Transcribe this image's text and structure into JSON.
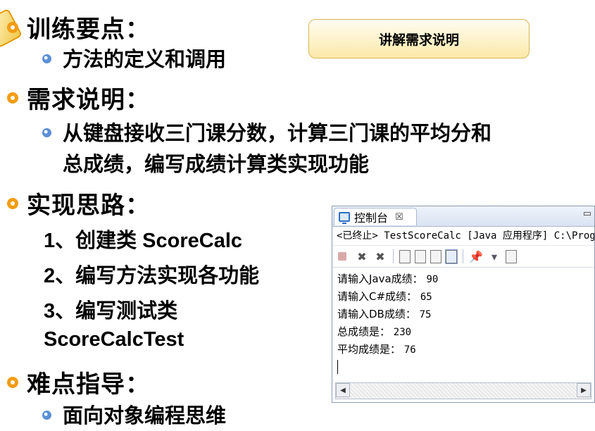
{
  "sections": {
    "points": {
      "title": "训练要点：",
      "items": [
        "方法的定义和调用"
      ]
    },
    "requirement": {
      "title": "需求说明：",
      "lines": [
        "从键盘接收三门课分数，计算三门课的平均分和",
        "总成绩，编写成绩计算类实现功能"
      ]
    },
    "approach": {
      "title": "实现思路：",
      "steps": [
        "1、创建类 ScoreCalc",
        "2、编写方法实现各功能",
        "3、编写测试类",
        "ScoreCalcTest"
      ]
    },
    "difficulty": {
      "title": "难点指导：",
      "items": [
        "面向对象编程思维"
      ]
    }
  },
  "callout": {
    "label": "讲解需求说明"
  },
  "console": {
    "tab_label": "控制台",
    "tab_close": "☒",
    "minimize": "▭",
    "path": "<已终止> TestScoreCalc [Java 应用程序] C:\\Prog",
    "output": [
      {
        "prompt": "请输入Java成绩：",
        "value": "90"
      },
      {
        "prompt": "请输入C#成绩：",
        "value": "65"
      },
      {
        "prompt": "请输入DB成绩：",
        "value": "75"
      },
      {
        "prompt": "总成绩是：",
        "value": "230"
      },
      {
        "prompt": "平均成绩是：",
        "value": "76"
      }
    ]
  },
  "colors": {
    "bullet_ring": "#f39c12",
    "bullet_dot": "#5b8fd6",
    "callout_bg": "#fbe9a8"
  },
  "icons": [
    "monitor-icon",
    "stop-icon",
    "remove-icon",
    "remove-all-icon",
    "scroll-lock-icon",
    "pin-icon",
    "open-console-icon",
    "new-console-icon"
  ]
}
